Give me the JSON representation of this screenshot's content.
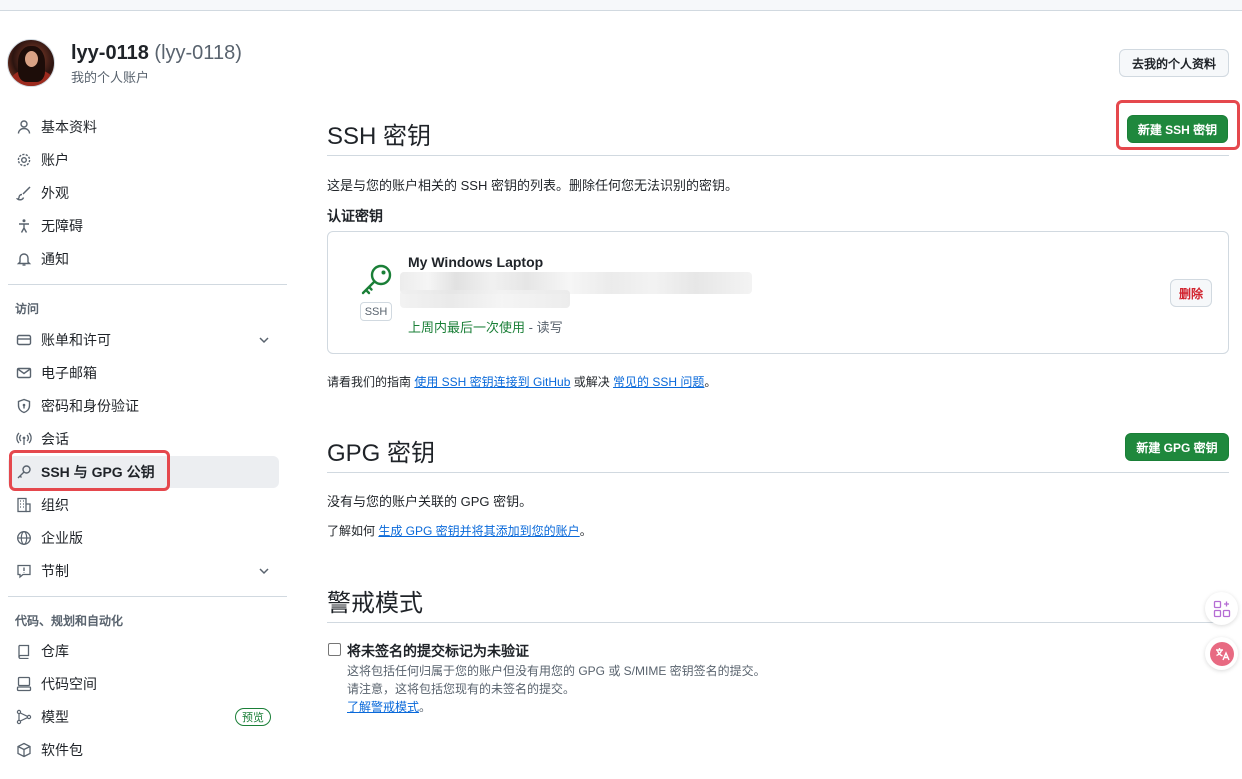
{
  "profile": {
    "username": "lyy-0118",
    "login": "(lyy-0118)",
    "subtitle": "我的个人账户",
    "go_profile_label": "去我的个人资料"
  },
  "sidebar": {
    "items_top": [
      {
        "label": "基本资料",
        "icon": "person-icon"
      },
      {
        "label": "账户",
        "icon": "gear-icon"
      },
      {
        "label": "外观",
        "icon": "paintbrush-icon"
      },
      {
        "label": "无障碍",
        "icon": "accessibility-icon"
      },
      {
        "label": "通知",
        "icon": "bell-icon"
      }
    ],
    "group_access": "访问",
    "items_access": [
      {
        "label": "账单和许可",
        "icon": "credit-card-icon",
        "expandable": true
      },
      {
        "label": "电子邮箱",
        "icon": "mail-icon"
      },
      {
        "label": "密码和身份验证",
        "icon": "shield-lock-icon"
      },
      {
        "label": "会话",
        "icon": "broadcast-icon"
      },
      {
        "label": "SSH 与 GPG 公钥",
        "icon": "key-icon",
        "active": true
      },
      {
        "label": "组织",
        "icon": "organization-icon"
      },
      {
        "label": "企业版",
        "icon": "globe-icon"
      },
      {
        "label": "节制",
        "icon": "report-icon",
        "expandable": true
      }
    ],
    "group_code": "代码、规划和自动化",
    "items_code": [
      {
        "label": "仓库",
        "icon": "repo-icon"
      },
      {
        "label": "代码空间",
        "icon": "codespaces-icon"
      },
      {
        "label": "模型",
        "icon": "model-icon",
        "badge": "预览"
      },
      {
        "label": "软件包",
        "icon": "package-icon"
      }
    ]
  },
  "ssh": {
    "title": "SSH 密钥",
    "new_button": "新建 SSH 密钥",
    "description": "这是与您的账户相关的 SSH 密钥的列表。删除任何您无法识别的密钥。",
    "auth_heading": "认证密钥",
    "key": {
      "title": "My Windows Laptop",
      "type_label": "SSH",
      "last_used": "上周内最后一次使用",
      "separator": " - ",
      "access": "读写",
      "delete_label": "删除"
    },
    "guide_prefix": "请看我们的指南 ",
    "guide_link": "使用 SSH 密钥连接到 GitHub",
    "guide_middle": " 或解决 ",
    "guide_link2": "常见的 SSH 问题",
    "guide_suffix": "。"
  },
  "gpg": {
    "title": "GPG 密钥",
    "new_button": "新建 GPG 密钥",
    "empty_text": "没有与您的账户关联的 GPG 密钥。",
    "learn_prefix": "了解如何 ",
    "learn_link": "生成 GPG 密钥并将其添加到您的账户",
    "learn_suffix": "。"
  },
  "vigilant": {
    "title": "警戒模式",
    "checkbox_label": "将未签名的提交标记为未验证",
    "checked": false,
    "desc1": "这将包括任何归属于您的账户但没有用您的 GPG 或 S/MIME 密钥签名的提交。",
    "desc2": "请注意，这将包括您现有的未签名的提交。",
    "learn_link": "了解警戒模式",
    "learn_suffix": "。"
  },
  "colors": {
    "accent_green": "#1f883d",
    "link_blue": "#0969da",
    "danger_red": "#d1242f",
    "annotation_red": "#e5484d"
  }
}
